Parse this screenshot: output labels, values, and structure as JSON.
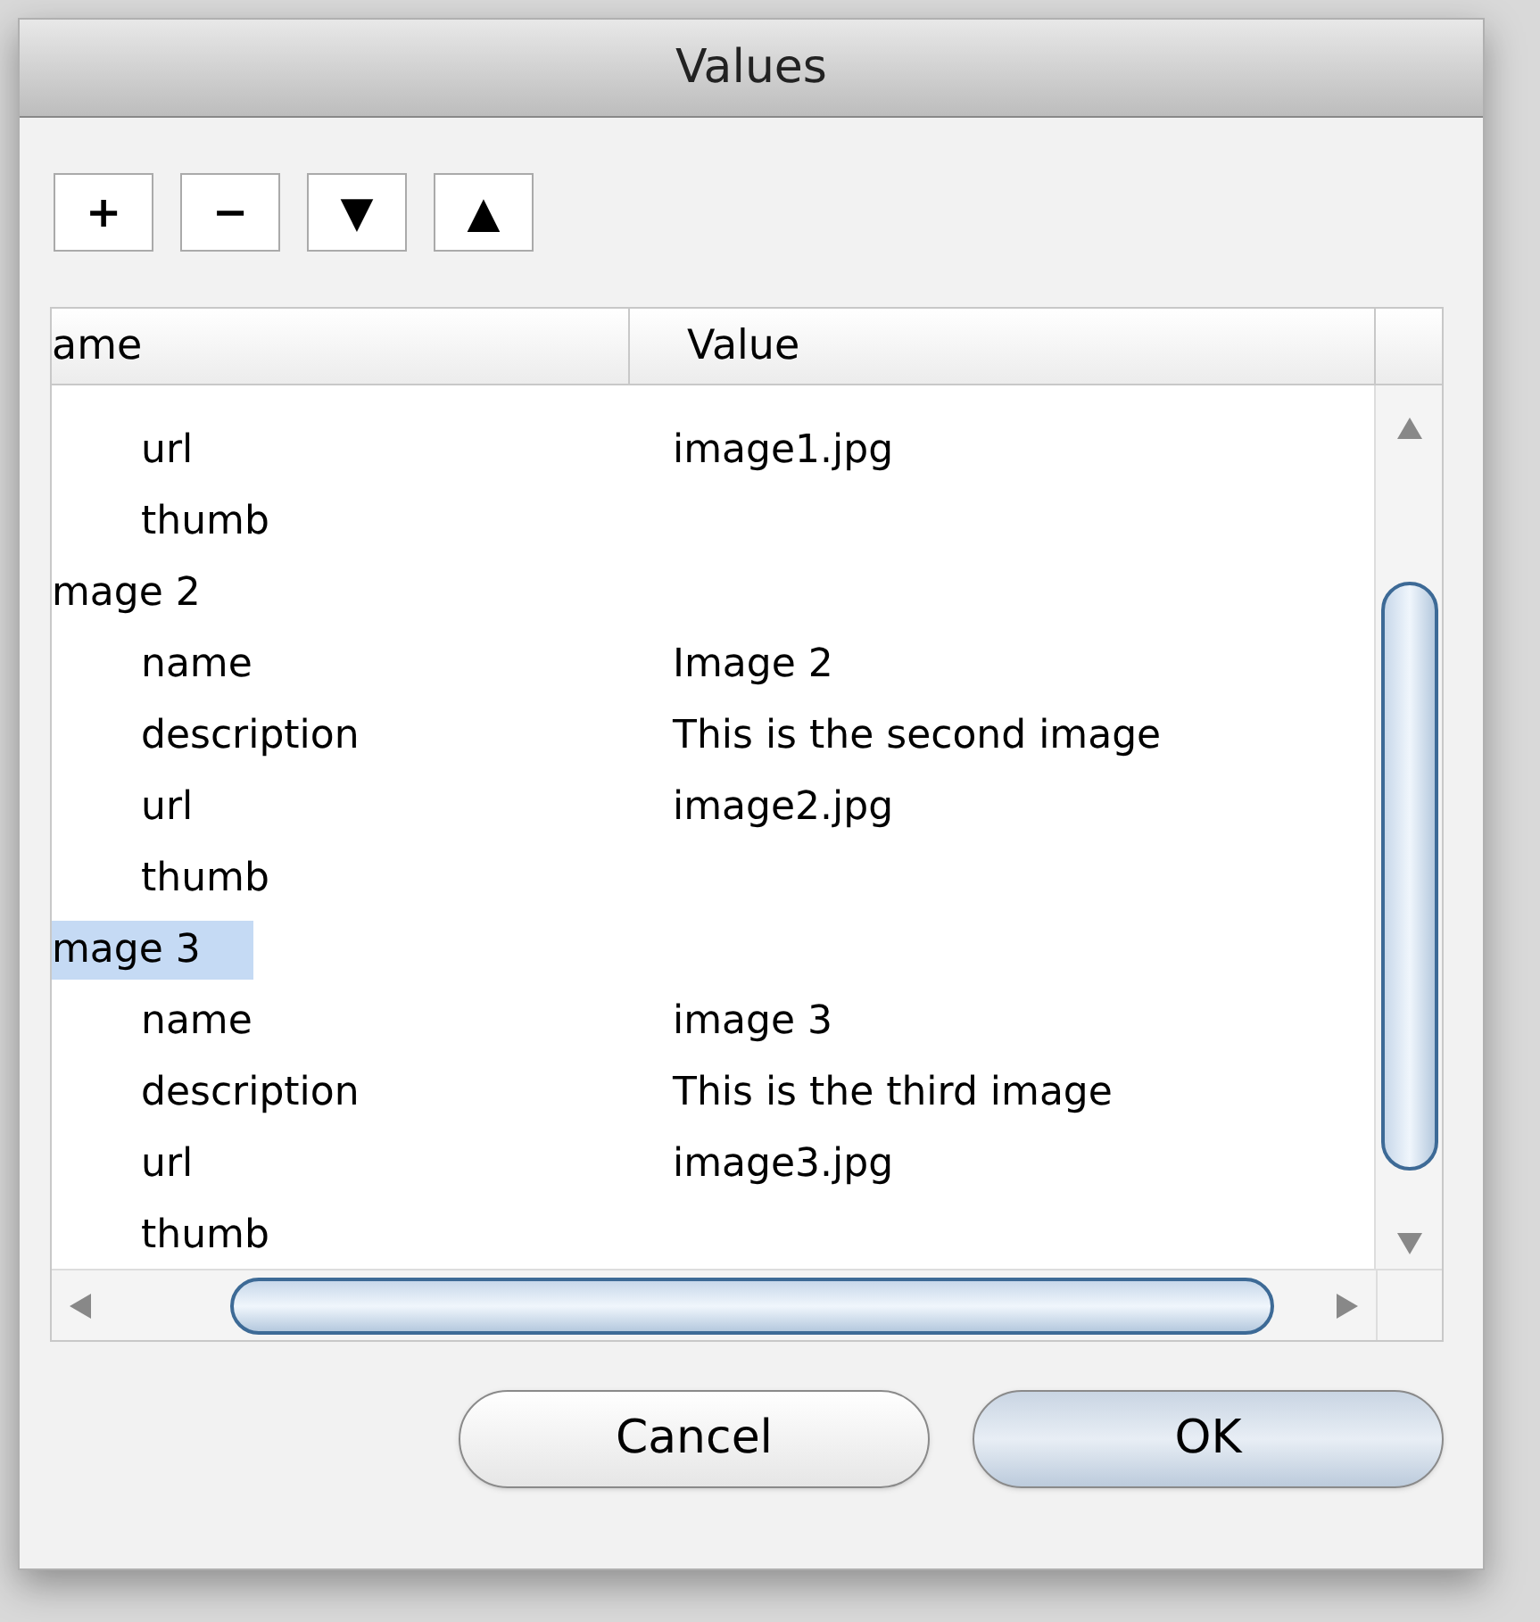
{
  "window": {
    "title": "Values"
  },
  "toolbar": [
    {
      "label": "+"
    },
    {
      "label": "−"
    },
    {
      "label": "▼"
    },
    {
      "label": "▲"
    }
  ],
  "table": {
    "columns": [
      "ame",
      "Value"
    ],
    "tree": [
      {
        "children": [
          {
            "name": "url",
            "value": "image1.jpg",
            "selected": false
          },
          {
            "name": "thumb",
            "selected": false
          }
        ]
      },
      {
        "name": "mage 2",
        "selected": false,
        "children": [
          {
            "name": "name",
            "value": "Image 2",
            "selected": false
          },
          {
            "name": "description",
            "value": "This is the second image",
            "selected": false
          },
          {
            "name": "url",
            "value": "image2.jpg",
            "selected": false
          },
          {
            "name": "thumb",
            "selected": false
          }
        ]
      },
      {
        "name": "mage 3",
        "selected": true,
        "children": [
          {
            "name": "name",
            "value": "image 3",
            "selected": false
          },
          {
            "name": "description",
            "value": "This is the third image",
            "selected": false
          },
          {
            "name": "url",
            "value": "image3.jpg",
            "selected": false
          },
          {
            "name": "thumb",
            "selected": false
          }
        ]
      }
    ]
  },
  "buttons": [
    {
      "label": "Cancel",
      "default": false
    },
    {
      "label": "OK",
      "default": true
    }
  ]
}
